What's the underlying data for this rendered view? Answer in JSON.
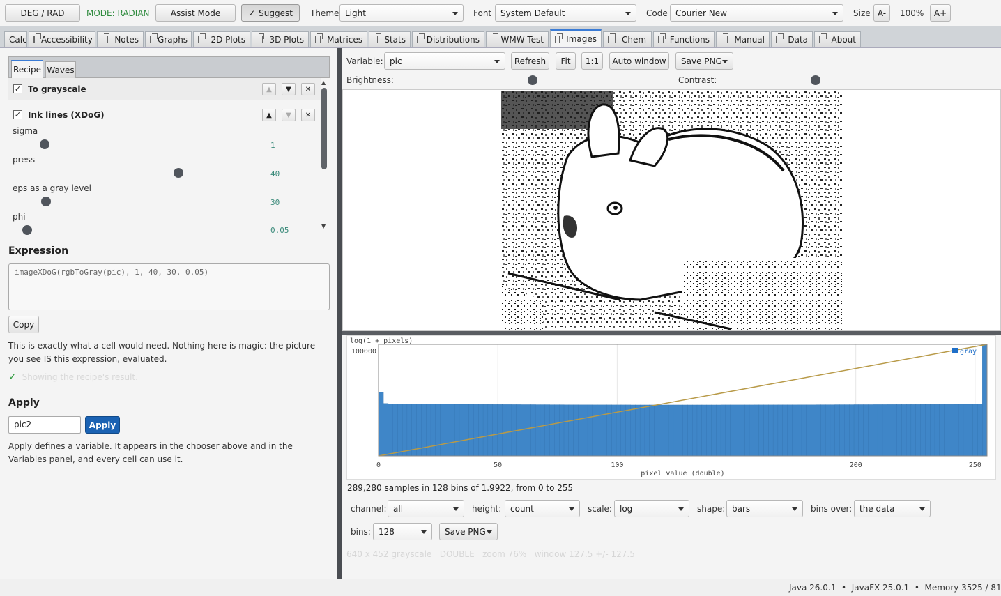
{
  "toolbar": {
    "deg_rad": "DEG / RAD",
    "mode": "MODE: RADIAN",
    "assist": "Assist Mode",
    "suggest": "Suggest",
    "theme_label": "Theme",
    "theme_value": "Light",
    "font_label": "Font",
    "font_value": "System Default",
    "code_label": "Code",
    "code_value": "Courier New",
    "size_label": "Size",
    "size_dec": "A-",
    "size_value": "100%",
    "size_inc": "A+"
  },
  "tabs": [
    "Calc",
    "Accessibility",
    "Notes",
    "Graphs",
    "2D Plots",
    "3D Plots",
    "Matrices",
    "Stats",
    "Distributions",
    "WMW Test",
    "Images",
    "Chem",
    "Functions",
    "Manual",
    "Data",
    "About"
  ],
  "active_tab": "Images",
  "left": {
    "subtabs": [
      "Recipe",
      "Waves"
    ],
    "steps": [
      {
        "label": "To grayscale",
        "checked": true
      },
      {
        "label": "Ink lines (XDoG)",
        "checked": true
      }
    ],
    "params": [
      {
        "name": "sigma",
        "value": "1"
      },
      {
        "name": "press",
        "value": "40"
      },
      {
        "name": "eps as a gray level",
        "value": "30"
      },
      {
        "name": "phi",
        "value": "0.05"
      }
    ],
    "expression_title": "Expression",
    "expression": "imageXDoG(rgbToGray(pic), 1, 40, 30, 0.05)",
    "copy": "Copy",
    "note": "This is exactly what a cell would need. Nothing here is magic: the picture you see IS this expression, evaluated.",
    "status": "Showing the recipe's result.",
    "apply_title": "Apply",
    "apply_input": "pic2",
    "apply_button": "Apply",
    "apply_note": "Apply defines a variable. It appears in the chooser above and in the Variables panel, and every cell can use it."
  },
  "right": {
    "variable_label": "Variable:",
    "variable_value": "pic",
    "refresh": "Refresh",
    "fit": "Fit",
    "one_to_one": "1:1",
    "auto_window": "Auto window",
    "save_png": "Save PNG",
    "brightness_label": "Brightness:",
    "contrast_label": "Contrast:",
    "brightness_level": 0.5,
    "contrast_level": 0.5,
    "summary": "289,280 samples in 128 bins of 1.9922, from 0 to 255",
    "channel_label": "channel:",
    "channel_value": "all",
    "height_label": "height:",
    "height_value": "count",
    "scale_label": "scale:",
    "scale_value": "log",
    "shape_label": "shape:",
    "shape_value": "bars",
    "binsover_label": "bins over:",
    "binsover_value": "the data",
    "bins_label": "bins:",
    "bins_value": "128",
    "save_png2": "Save PNG",
    "info": "640 x 452 grayscale   DOUBLE   zoom 76%   window 127.5 +/- 127.5"
  },
  "chart_data": {
    "type": "bar",
    "ylabel": "log(1 + pixels)",
    "xlabel": "pixel value (double)",
    "xlim": [
      0,
      255
    ],
    "x_ticks": [
      0,
      50,
      100,
      200,
      250
    ],
    "y_ticks": [
      100000
    ],
    "series": [
      {
        "name": "gray",
        "values": [
          700,
          225,
          215,
          213,
          212,
          211,
          210,
          210,
          209,
          209,
          208,
          208,
          207,
          207,
          206,
          206,
          205,
          205,
          204,
          204,
          203,
          203,
          202,
          202,
          201,
          201,
          200,
          200,
          199,
          199,
          198,
          198,
          198,
          197,
          197,
          197,
          196,
          196,
          196,
          195,
          195,
          195,
          194,
          194,
          194,
          193,
          193,
          193,
          193,
          192,
          192,
          192,
          192,
          191,
          191,
          191,
          191,
          191,
          191,
          191,
          191,
          191,
          191,
          191,
          191,
          191,
          191,
          191,
          191,
          191,
          191,
          191,
          192,
          192,
          192,
          192,
          192,
          192,
          192,
          193,
          193,
          193,
          193,
          193,
          194,
          194,
          194,
          194,
          195,
          195,
          195,
          195,
          196,
          196,
          196,
          196,
          197,
          197,
          197,
          197,
          198,
          198,
          198,
          198,
          199,
          199,
          199,
          200,
          200,
          200,
          200,
          201,
          201,
          201,
          202,
          202,
          202,
          202,
          203,
          203,
          203,
          204,
          204,
          205,
          205,
          206,
          207,
          100000
        ]
      }
    ],
    "legend": "top-right",
    "colors": {
      "bars": "#3f86c8",
      "line": "#b89a48"
    }
  }
}
